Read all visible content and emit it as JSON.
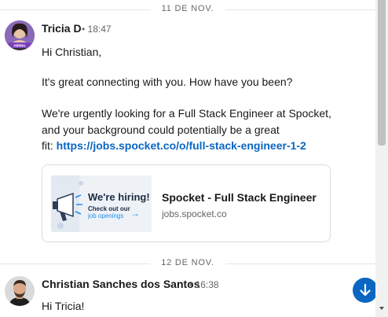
{
  "dividers": {
    "first": "11 DE NOV.",
    "second": "12 DE NOV."
  },
  "messages": [
    {
      "sender": "Tricia D",
      "time": "• 18:47",
      "lines": [
        "Hi Christian,",
        "It's great connecting with you. How have you been?",
        "We're urgently looking for a Full Stack Engineer at Spocket,",
        "and your background could potentially be a great"
      ],
      "last_line_prefix": "fit: ",
      "link_text": "https://jobs.spocket.co/o/full-stack-engineer-1-2",
      "card": {
        "title": "Spocket - Full Stack Engineer",
        "domain": "jobs.spocket.co",
        "thumb_heading": "We're hiring!",
        "thumb_sub1": "Check out our",
        "thumb_sub2": "job openings"
      },
      "avatar_badge": "HIRING"
    },
    {
      "sender": "Christian Sanches dos Santos",
      "time": "• 16:38",
      "lines": [
        "Hi Tricia!"
      ]
    }
  ],
  "colors": {
    "accent": "#0a66c2",
    "text": "#191919",
    "muted": "#666666",
    "divider": "#e4e4e4"
  },
  "icons": {
    "jump": "arrow-down-icon",
    "scroll": "scroll-down-arrow-icon"
  }
}
